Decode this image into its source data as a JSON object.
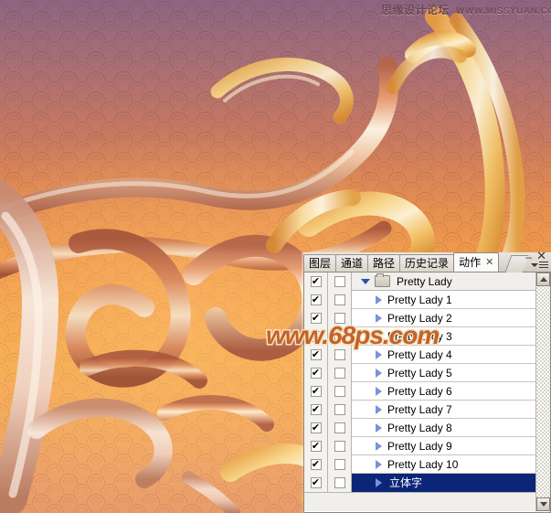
{
  "watermarks": {
    "top_cn": "思缘设计论坛",
    "top_url": "WWW.MISSYUAN.COM",
    "center": "www.68ps.com"
  },
  "panel": {
    "tabs": [
      {
        "label": "图层",
        "active": false,
        "closable": false
      },
      {
        "label": "通道",
        "active": false,
        "closable": false
      },
      {
        "label": "路径",
        "active": false,
        "closable": false
      },
      {
        "label": "历史记录",
        "active": false,
        "closable": false
      },
      {
        "label": "动作",
        "active": true,
        "closable": true
      }
    ],
    "tab_close_glyph": "✕",
    "window_controls": {
      "minimize": "–",
      "close": "✕"
    },
    "menu_icon": "panel-menu-icon",
    "columns": {
      "toggle_on": "✔",
      "toggle_off": ""
    },
    "rows": [
      {
        "label": "Pretty Lady",
        "type": "group",
        "expanded": true,
        "checked": true,
        "second": false,
        "selected": false
      },
      {
        "label": "Pretty Lady 1",
        "type": "action",
        "expanded": false,
        "checked": true,
        "second": false,
        "selected": false
      },
      {
        "label": "Pretty Lady 2",
        "type": "action",
        "expanded": false,
        "checked": true,
        "second": false,
        "selected": false
      },
      {
        "label": "Pretty Lady 3",
        "type": "action",
        "expanded": false,
        "checked": true,
        "second": false,
        "selected": false
      },
      {
        "label": "Pretty Lady 4",
        "type": "action",
        "expanded": false,
        "checked": true,
        "second": false,
        "selected": false
      },
      {
        "label": "Pretty Lady 5",
        "type": "action",
        "expanded": false,
        "checked": true,
        "second": false,
        "selected": false
      },
      {
        "label": "Pretty Lady 6",
        "type": "action",
        "expanded": false,
        "checked": true,
        "second": false,
        "selected": false
      },
      {
        "label": "Pretty Lady 7",
        "type": "action",
        "expanded": false,
        "checked": true,
        "second": false,
        "selected": false
      },
      {
        "label": "Pretty Lady 8",
        "type": "action",
        "expanded": false,
        "checked": true,
        "second": false,
        "selected": false
      },
      {
        "label": "Pretty Lady 9",
        "type": "action",
        "expanded": false,
        "checked": true,
        "second": false,
        "selected": false
      },
      {
        "label": "Pretty Lady 10",
        "type": "action",
        "expanded": false,
        "checked": true,
        "second": false,
        "selected": false
      },
      {
        "label": "立体字",
        "type": "action",
        "expanded": false,
        "checked": true,
        "second": false,
        "selected": true
      }
    ]
  },
  "colors": {
    "selection": "#0b2578",
    "triangle": "#7b93d6",
    "panel_bg": "#ffffff",
    "tab_active_bg": "#fbfbfa",
    "watermark_center": "#c4622a",
    "watermark_center_outline": "#f4e3c2",
    "bg_top": "#8d6480",
    "bg_bottom": "#f3a44d"
  }
}
